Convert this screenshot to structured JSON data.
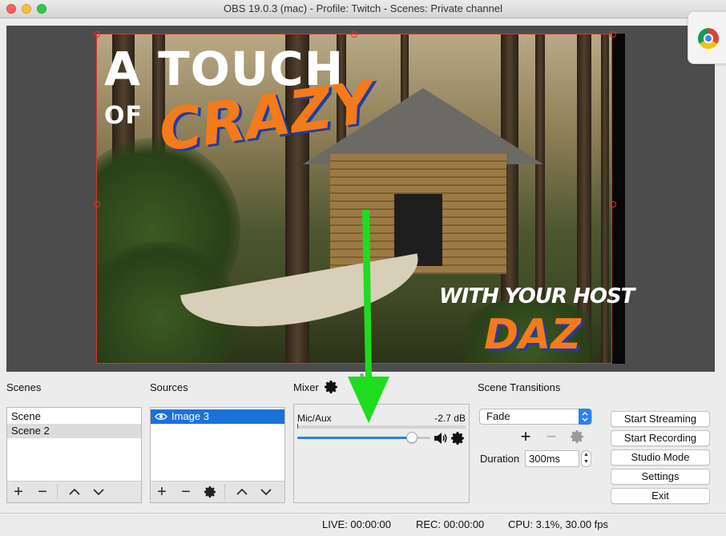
{
  "window": {
    "title": "OBS 19.0.3 (mac) - Profile: Twitch - Scenes: Private channel"
  },
  "preview": {
    "overlay_line1": "A TOUCH",
    "overlay_line2": "OF",
    "overlay_crazy": "CRAZY",
    "overlay_host": "WITH YOUR HOST",
    "overlay_name": "DAZ"
  },
  "docks": {
    "scenes_label": "Scenes",
    "sources_label": "Sources",
    "mixer_label": "Mixer",
    "transitions_label": "Scene Transitions"
  },
  "scenes": {
    "items": [
      "Scene",
      "Scene 2"
    ],
    "selected": "Scene 2"
  },
  "sources": {
    "items": [
      "Image 3"
    ],
    "selected": "Image 3"
  },
  "mixer": {
    "channel_name": "Mic/Aux",
    "db_value": "-2.7 dB",
    "volume_fraction": 0.86
  },
  "transitions": {
    "selected": "Fade",
    "duration_label": "Duration",
    "duration_value": "300ms"
  },
  "controls": {
    "start_streaming": "Start Streaming",
    "start_recording": "Start Recording",
    "studio_mode": "Studio Mode",
    "settings": "Settings",
    "exit": "Exit"
  },
  "status": {
    "live": "LIVE: 00:00:00",
    "rec": "REC: 00:00:00",
    "cpu": "CPU: 3.1%, 30.00 fps"
  },
  "colors": {
    "accent": "#1a72d9",
    "arrow": "#1fdc1f",
    "overlay_orange": "#f57a1a",
    "selection": "#e03030"
  }
}
